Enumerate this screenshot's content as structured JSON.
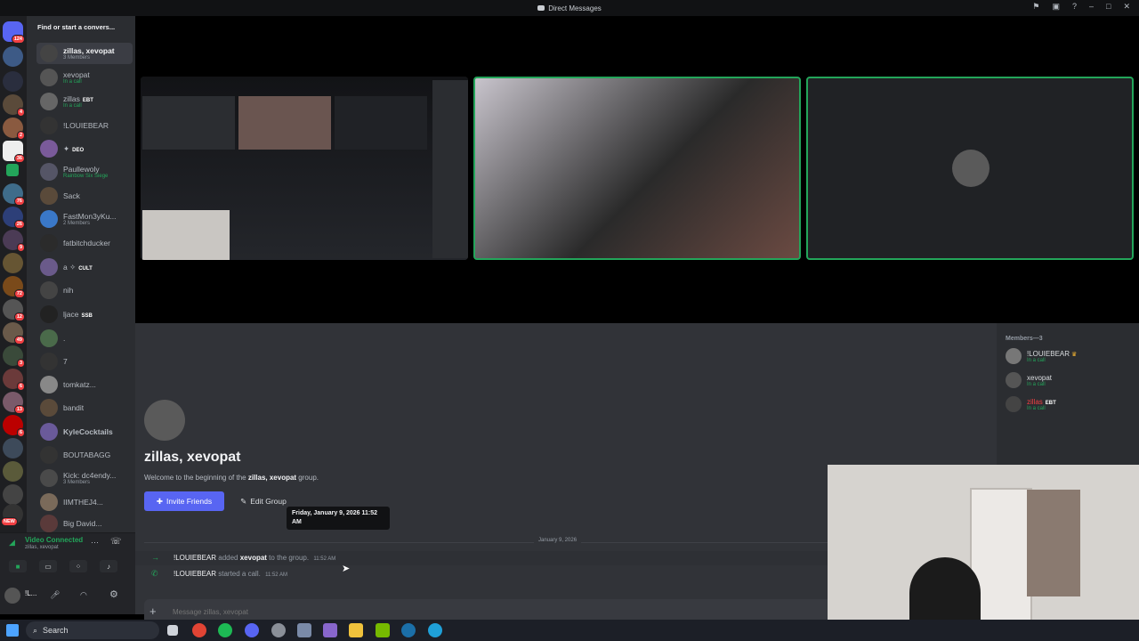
{
  "window": {
    "title": "Direct Messages",
    "icon": "discord-icon"
  },
  "rail": {
    "badges": [
      "124",
      "",
      "",
      "4",
      "2",
      "36",
      "",
      "",
      "76",
      "26",
      "9",
      "",
      "72",
      "12",
      "49",
      "3",
      "6",
      "13",
      "6",
      "NEW"
    ]
  },
  "dm": {
    "search_placeholder": "Find or start a convers...",
    "items": [
      {
        "name": "zillas, xevopat",
        "sub": "3 Members"
      },
      {
        "name": "xevopat",
        "sub": "In a call"
      },
      {
        "name": "zillas",
        "tag": "EBT",
        "sub": "In a call"
      },
      {
        "name": "!LOUIEBEAR",
        "sub": ""
      },
      {
        "name": "✦",
        "tag": "DEO",
        "sub": ""
      },
      {
        "name": "Paullewoly",
        "sub": "Rainbow Six Siege"
      },
      {
        "name": "Sack",
        "sub": ""
      },
      {
        "name": "FastMon3yKu...",
        "sub": "2 Members"
      },
      {
        "name": "fatbitchducker",
        "sub": ""
      },
      {
        "name": "a ✧",
        "tag": "CULT",
        "sub": ""
      },
      {
        "name": "nih",
        "sub": ""
      },
      {
        "name": "ljace",
        "tag": "SSB",
        "sub": ""
      },
      {
        "name": ".",
        "sub": ""
      },
      {
        "name": "7",
        "sub": ""
      },
      {
        "name": "tomkatz...",
        "sub": ""
      },
      {
        "name": "bandit",
        "sub": ""
      },
      {
        "name": "KyleCocktails",
        "sub": ""
      },
      {
        "name": "BOUTABAGG",
        "sub": ""
      },
      {
        "name": "Kick: dc4endy...",
        "sub": "3 Members"
      },
      {
        "name": "IIMTHEJ4...",
        "sub": ""
      },
      {
        "name": "Big David...",
        "sub": ""
      }
    ]
  },
  "voice": {
    "status": "Video Connected",
    "channel": "zillas, xevopat"
  },
  "user": {
    "name": "!L..."
  },
  "chat": {
    "group_title": "zillas, xevopat",
    "welcome_prefix": "Welcome to the beginning of the ",
    "welcome_group": "zillas, xevopat",
    "welcome_suffix": " group.",
    "invite_label": "Invite Friends",
    "edit_label": "Edit Group",
    "tooltip": "Friday, January 9, 2026 11:52 AM",
    "date_divider": "January 9, 2026",
    "messages": [
      {
        "actor": "!LOUIEBEAR",
        "text": " added ",
        "target": "xevopat",
        "suffix": " to the group.",
        "time": "11:52 AM"
      },
      {
        "actor": "!LOUIEBEAR",
        "text": " started a call.",
        "target": "",
        "suffix": "",
        "time": "11:52 AM"
      }
    ],
    "input_placeholder": "Message zillas, xevopat"
  },
  "members": {
    "header": "Members—3",
    "list": [
      {
        "name": "!LOUIEBEAR",
        "status": "In a call"
      },
      {
        "name": "xevopat",
        "status": "In a call"
      },
      {
        "name": "zillas",
        "tag": "EBT",
        "status": "In a call"
      }
    ]
  },
  "taskbar": {
    "search_label": "Search"
  },
  "colors": {
    "accent": "#5865f2",
    "online": "#23a55a",
    "danger": "#f23f42"
  }
}
